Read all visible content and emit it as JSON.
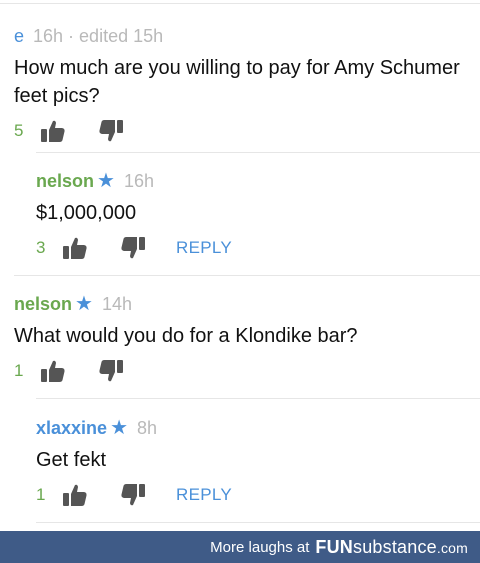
{
  "comments": [
    {
      "username": "e",
      "has_star": false,
      "time": "16h · edited 15h",
      "text": "How much are you willing to pay for Amy Schumer feet pics?",
      "upvotes": "5",
      "reply_label": ""
    },
    {
      "username": "nelson",
      "has_star": true,
      "time": "16h",
      "text": "$1,000,000",
      "upvotes": "3",
      "reply_label": "REPLY"
    },
    {
      "username": "nelson",
      "has_star": true,
      "time": "14h",
      "text": "What would you do for a Klondike bar?",
      "upvotes": "1",
      "reply_label": ""
    },
    {
      "username": "xlaxxine",
      "has_star": true,
      "time": "8h",
      "text": "Get fekt",
      "upvotes": "1",
      "reply_label": "REPLY"
    }
  ],
  "star_glyph": "★",
  "icons": {
    "upvote": "thumbs-up-icon",
    "downvote": "thumbs-down-icon",
    "star": "star-icon"
  },
  "colors": {
    "username_blue": "#4a90d9",
    "username_green": "#6aa84f",
    "star": "#4a90d9",
    "count": "#6aa84f",
    "timestamp": "#b9b9b9",
    "reply": "#4a90d9",
    "footer_bg": "#3f5b87"
  },
  "footer": {
    "text": "More laughs at",
    "brand_part1": "FUN",
    "brand_part2": "substance",
    "brand_part3": ".com"
  }
}
